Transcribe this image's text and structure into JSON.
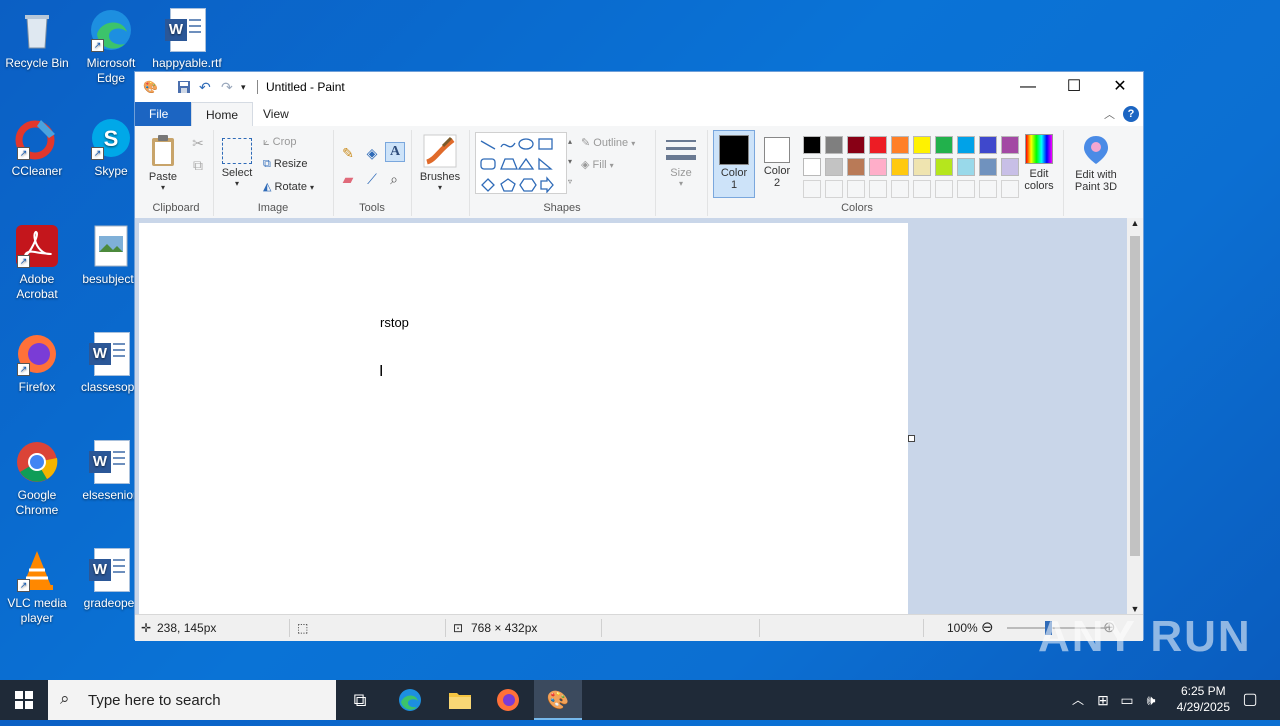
{
  "desktop": {
    "icons": [
      {
        "label": "Recycle Bin"
      },
      {
        "label": "Microsoft Edge"
      },
      {
        "label": "happyable.rtf"
      },
      {
        "label": "CCleaner"
      },
      {
        "label": "Skype"
      },
      {
        "label": "Adobe Acrobat"
      },
      {
        "label": "besubject.j"
      },
      {
        "label": "Firefox"
      },
      {
        "label": "classesopp"
      },
      {
        "label": "Google Chrome"
      },
      {
        "label": "elsesenior."
      },
      {
        "label": "VLC media player"
      },
      {
        "label": "gradeoper"
      }
    ]
  },
  "window": {
    "title": "Untitled - Paint",
    "tabs": [
      "File",
      "Home",
      "View"
    ],
    "ribbon": {
      "clipboard": {
        "paste": "Paste",
        "group": "Clipboard"
      },
      "image": {
        "select": "Select",
        "crop": "Crop",
        "resize": "Resize",
        "rotate": "Rotate",
        "group": "Image"
      },
      "tools": {
        "group": "Tools"
      },
      "brushes": {
        "label": "Brushes"
      },
      "shapes": {
        "outline": "Outline",
        "fill": "Fill",
        "group": "Shapes"
      },
      "size": {
        "label": "Size"
      },
      "colors": {
        "color1": "Color\n1",
        "color1_line1": "Color",
        "color1_line2": "1",
        "color2_line1": "Color",
        "color2_line2": "2",
        "edit_line1": "Edit",
        "edit_line2": "colors",
        "paint3d_line1": "Edit with",
        "paint3d_line2": "Paint 3D",
        "group": "Colors",
        "palette_row1": [
          "#000000",
          "#7f7f7f",
          "#880015",
          "#ed1c24",
          "#ff7f27",
          "#fff200",
          "#22b14c",
          "#00a2e8",
          "#3f48cc",
          "#a349a4"
        ],
        "palette_row2": [
          "#ffffff",
          "#c3c3c3",
          "#b97a57",
          "#ffaec9",
          "#ffc90e",
          "#efe4b0",
          "#b5e61d",
          "#99d9ea",
          "#7092be",
          "#c8bfe7"
        ]
      }
    },
    "canvas": {
      "text": "rstop"
    },
    "status": {
      "cursor": "238, 145px",
      "size": "768 × 432px",
      "zoom": "100%"
    }
  },
  "taskbar": {
    "search_placeholder": "Type here to search",
    "time": "6:25 PM",
    "date": "4/29/2025"
  },
  "watermark": "ANY RUN"
}
